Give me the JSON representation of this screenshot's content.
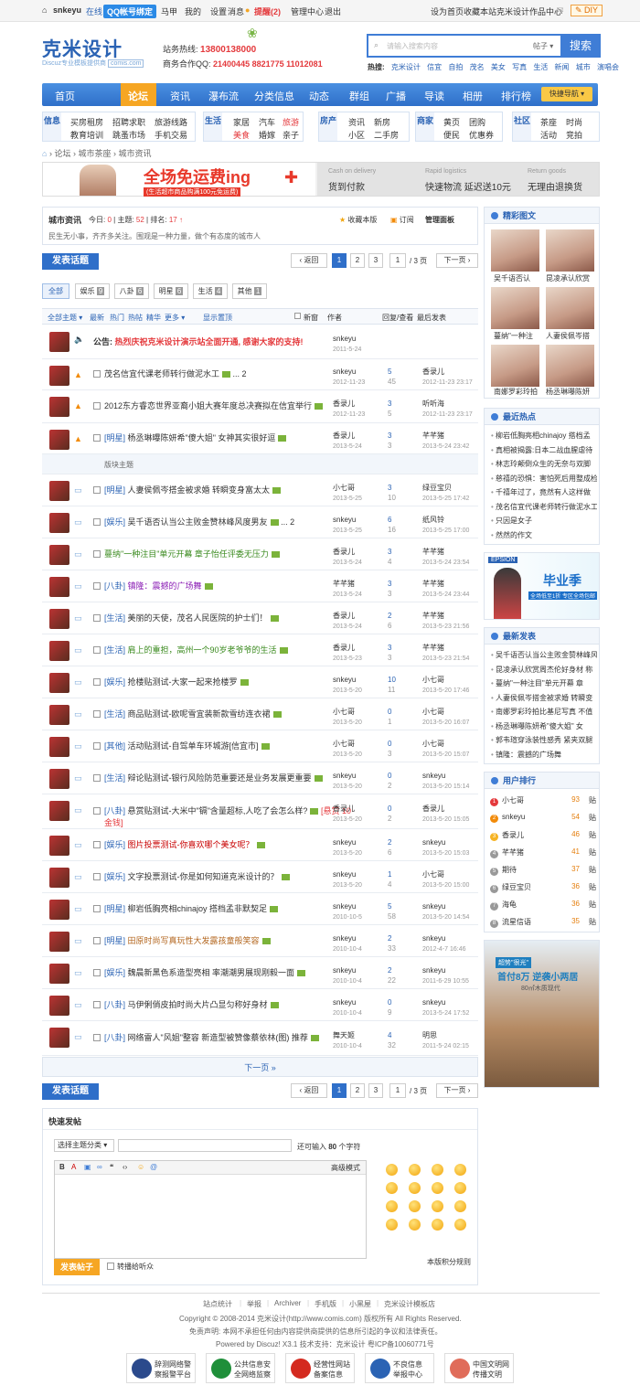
{
  "topbar": {
    "username": "snkeyu",
    "status": "在线",
    "qq_bind": "QQ帐号绑定",
    "links_left": [
      "马甲",
      "我的",
      "设置",
      "消息",
      "提醒(2)",
      "管理中心",
      "退出"
    ],
    "links_right": [
      "设为首页",
      "收藏本站",
      "克米设计作品中心"
    ],
    "diy": "DIY"
  },
  "header": {
    "logo": "克米设计",
    "logo_sub": "Discuz专业模板提供商",
    "logo_domain": "comis.com",
    "hotline_label": "站务热线:",
    "hotline": "13800138000",
    "qq_label": "商务合作QQ:",
    "qq": "21400445 8821775 11012081"
  },
  "search": {
    "placeholder": "请输入搜索内容",
    "type": "帖子",
    "button": "搜索",
    "hot_label": "热搜:",
    "hot": [
      "克米设计",
      "信宜",
      "自拍",
      "茂名",
      "美女",
      "写真",
      "生活",
      "新闻",
      "城市",
      "演唱会"
    ]
  },
  "nav": {
    "items": [
      "首页",
      "论坛",
      "资讯",
      "瀑布流",
      "分类信息",
      "动态",
      "群组",
      "广播",
      "导读",
      "相册",
      "排行榜"
    ],
    "active": "论坛",
    "quick": "快捷导航"
  },
  "categories": [
    {
      "label": "信息",
      "links": [
        "买房租房",
        "招聘求职",
        "旅游线路",
        "教育培训",
        "跳蚤市场",
        "手机交易"
      ]
    },
    {
      "label": "生活",
      "links": [
        "家居",
        "汽车",
        "旅游",
        "美食",
        "婚嫁",
        "亲子"
      ]
    },
    {
      "label": "房产",
      "links": [
        "资讯",
        "新房",
        "小区",
        "二手房"
      ]
    },
    {
      "label": "商家",
      "links": [
        "黄页",
        "团购",
        "便民",
        "优惠券"
      ]
    },
    {
      "label": "社区",
      "links": [
        "茶座",
        "时尚",
        "活动",
        "竞拍"
      ]
    }
  ],
  "breadcrumb": [
    "论坛",
    "城市茶座",
    "城市资讯"
  ],
  "banner": {
    "main": "全场免运费ing",
    "sub": "(生活超市商品购满100元免运费)",
    "items": [
      {
        "en": "Cash on delivery",
        "cn": "货到付款"
      },
      {
        "en": "Rapid logistics",
        "cn": "快速物流 延迟送10元"
      },
      {
        "en": "Return goods",
        "cn": "无理由退换货"
      }
    ]
  },
  "forum": {
    "name": "城市资讯",
    "today_label": "今日:",
    "today": "0",
    "topics_label": "主题:",
    "topics": "52",
    "rank_label": "排名:",
    "rank": "17",
    "fav": "收藏本版",
    "rss": "订阅",
    "manage": "管理面板",
    "desc": "民生无小事，齐齐多关注。围观是一种力量，做个有态度的城市人"
  },
  "post_button": "发表话题",
  "pager": {
    "back": "返回",
    "pages": [
      "1",
      "2",
      "3"
    ],
    "current": "1",
    "total": "/ 3 页",
    "next": "下一页"
  },
  "type_tabs": [
    {
      "label": "全部",
      "count": ""
    },
    {
      "label": "娱乐",
      "count": "9"
    },
    {
      "label": "八卦",
      "count": "6"
    },
    {
      "label": "明星",
      "count": "6"
    },
    {
      "label": "生活",
      "count": "4"
    },
    {
      "label": "其他",
      "count": "1"
    }
  ],
  "list_header": {
    "filters": [
      "全部主题",
      "最新",
      "热门",
      "热帖",
      "精华",
      "更多"
    ],
    "display": "显示置顶",
    "new_label": "新窗",
    "author": "作者",
    "reply_view": "回复/查看",
    "last_post": "最后发表"
  },
  "announcement": {
    "label": "公告:",
    "text": "热烈庆祝克米设计演示站全面开通, 感谢大家的支持!",
    "author": "snkeyu",
    "date": "2011-5-24"
  },
  "sticky": [
    {
      "title": "茂名信宜代课老师转行做泥水工",
      "extra": "... 2",
      "author": "snkeyu",
      "date": "2012-11-23",
      "replies": "5",
      "views": "45",
      "last": "香录儿",
      "last_date": "2012-11-23 23:17"
    },
    {
      "title": "2012东方睿恋世界亚裔小姐大赛年度总决赛拟在信宜举行",
      "extra": "",
      "author": "香录儿",
      "date": "2012-11-23",
      "replies": "3",
      "views": "5",
      "last": "听听海",
      "last_date": "2012-11-23 23:17"
    },
    {
      "tag": "[明星]",
      "title": "杨丞琳曝陈妍希\"傻大姐\" 女神其实很好逗",
      "extra": "",
      "author": "香录儿",
      "date": "2013-5-24",
      "replies": "3",
      "views": "3",
      "last": "芊芊猪",
      "last_date": "2013-5-24 23:42"
    }
  ],
  "section_divider": "版块主题",
  "threads": [
    {
      "tag": "[明星]",
      "title": "人妻侯佩岑搭金被求婚 转瞬变身富太太",
      "extra": "",
      "author": "小七哥",
      "date": "2013-5-25",
      "replies": "3",
      "views": "10",
      "last": "绿豆宝贝",
      "last_date": "2013-5-25 17:42",
      "color": ""
    },
    {
      "tag": "[娱乐]",
      "title": "吴千语否认当公主败金赞林峰风度男友",
      "extra": "... 2",
      "author": "snkeyu",
      "date": "2013-5-25",
      "replies": "6",
      "views": "16",
      "last": "纸风铃",
      "last_date": "2013-5-25 17:00",
      "color": ""
    },
    {
      "tag": "",
      "title": "蔓纳\"一种注目\"单元开幕 章子怡任评委无压力",
      "extra": "",
      "author": "香录儿",
      "date": "2013-5-24",
      "replies": "3",
      "views": "4",
      "last": "芊芊猪",
      "last_date": "2013-5-24 23:54",
      "color": "g"
    },
    {
      "tag": "[八卦]",
      "title": "镇隆：震撼的广场舞",
      "extra": "",
      "author": "芊芊猪",
      "date": "2013-5-24",
      "replies": "3",
      "views": "3",
      "last": "芊芊猪",
      "last_date": "2013-5-24 23:44",
      "color": "pu"
    },
    {
      "tag": "[生活]",
      "title": "美丽的天使，茂名人民医院的护士们！",
      "extra": "",
      "author": "香录儿",
      "date": "2013-5-24",
      "replies": "2",
      "views": "6",
      "last": "芊芊猪",
      "last_date": "2013-5-23 21:56",
      "color": ""
    },
    {
      "tag": "[生活]",
      "title": "肩上的重担，高州一个90岁老爷爷的生活",
      "extra": "",
      "author": "香录儿",
      "date": "2013-5-23",
      "replies": "3",
      "views": "3",
      "last": "芊芊猪",
      "last_date": "2013-5-23 21:54",
      "color": "g"
    },
    {
      "tag": "[娱乐]",
      "title": "抢楼贴测试-大家一起来抢楼罗",
      "extra": "",
      "author": "snkeyu",
      "date": "2013-5-20",
      "replies": "10",
      "views": "11",
      "last": "小七哥",
      "last_date": "2013-5-20 17:46",
      "color": ""
    },
    {
      "tag": "[生活]",
      "title": "商品贴测试-欧呢雪宜装新款雪纺连衣裙",
      "extra": "",
      "author": "小七哥",
      "date": "2013-5-20",
      "replies": "0",
      "views": "1",
      "last": "小七哥",
      "last_date": "2013-5-20 16:07",
      "color": ""
    },
    {
      "tag": "[其他]",
      "title": "活动贴测试-自驾单车环城游[信宜市]",
      "extra": "",
      "author": "小七哥",
      "date": "2013-5-20",
      "replies": "0",
      "views": "3",
      "last": "小七哥",
      "last_date": "2013-5-20 15:07",
      "color": ""
    },
    {
      "tag": "[生活]",
      "title": "辩论贴测试-银行风险防范重要还是业务发展更重要",
      "extra": "",
      "author": "snkeyu",
      "date": "2013-5-20",
      "replies": "0",
      "views": "2",
      "last": "snkeyu",
      "last_date": "2013-5-20 15:14",
      "color": ""
    },
    {
      "tag": "[八卦]",
      "title": "悬赏贴测试-大米中\"镉\"含量超标,人吃了会怎么样?",
      "extra": "[悬赏 10 金钱]",
      "author": "香录儿",
      "date": "2013-5-20",
      "replies": "0",
      "views": "2",
      "last": "香录儿",
      "last_date": "2013-5-20 15:05",
      "color": ""
    },
    {
      "tag": "[娱乐]",
      "title": "图片投票测试-你喜欢哪个美女呢？",
      "extra": "",
      "author": "snkeyu",
      "date": "2013-5-20",
      "replies": "2",
      "views": "6",
      "last": "snkeyu",
      "last_date": "2013-5-20 15:03",
      "color": "o"
    },
    {
      "tag": "[娱乐]",
      "title": "文字投票测试-你是如何知道克米设计的？",
      "extra": "",
      "author": "snkeyu",
      "date": "2013-5-20",
      "replies": "1",
      "views": "4",
      "last": "小七哥",
      "last_date": "2013-5-20 15:00",
      "color": ""
    },
    {
      "tag": "[明星]",
      "title": "柳岩低胸亮相chinajoy 搭档孟非默契足",
      "extra": "",
      "author": "snkeyu",
      "date": "2010-10-5",
      "replies": "5",
      "views": "58",
      "last": "snkeyu",
      "last_date": "2013-5-20 14:54",
      "color": ""
    },
    {
      "tag": "[明星]",
      "title": "田原时尚写真玩性大发露孩童般笑容",
      "extra": "",
      "author": "snkeyu",
      "date": "2010-10-4",
      "replies": "2",
      "views": "33",
      "last": "snkeyu",
      "last_date": "2012-4-7 16:46",
      "color": "br"
    },
    {
      "tag": "[娱乐]",
      "title": "魏晨新黑色系造型亮相 率潮潮男展现刚毅一面",
      "extra": "",
      "author": "snkeyu",
      "date": "2010-10-4",
      "replies": "2",
      "views": "22",
      "last": "snkeyu",
      "last_date": "2011-6-29 10:55",
      "color": ""
    },
    {
      "tag": "[八卦]",
      "title": "马伊俐俏皮拍时尚大片凸显匀称好身材",
      "extra": "",
      "author": "snkeyu",
      "date": "2010-10-4",
      "replies": "0",
      "views": "9",
      "last": "snkeyu",
      "last_date": "2013-5-24 17:52",
      "color": ""
    },
    {
      "tag": "[八卦]",
      "title": "网络雷人\"风姐\"整容 新造型被赞像蔡依林(图) 推荐",
      "extra": "",
      "author": "舞天姬",
      "date": "2010-10-4",
      "replies": "4",
      "views": "32",
      "last": "明思",
      "last_date": "2011-5-24 02:15",
      "color": ""
    }
  ],
  "next_page": "下一页 »",
  "quick_post": {
    "title": "快速发帖",
    "type_select": "选择主题分类",
    "limit_pre": "还可输入",
    "limit": "80",
    "limit_post": "个字符",
    "advanced": "高级模式",
    "submit": "发表帖子",
    "sync": "转播给听众",
    "rules": "本版积分规则"
  },
  "sidebar": {
    "pics_title": "精彩图文",
    "pics": [
      "吴千语否认",
      "昆凌承认欣赏",
      "蔓纳\"一种注",
      "人妻侯佩岑搭",
      "南娜罗彩玲拍",
      "杨丞琳曝陈妍"
    ],
    "hot_title": "最近热点",
    "hot": [
      "柳岩低胸亮相chinajoy 搭档孟",
      "真相被揭露:日本二战血腥虐待",
      "林志玲颠倒众生的无奈与双脚",
      "慈禧的恐惧：害怕死后用整成检",
      "千禧年过了，竟然有人这样做",
      "茂名信宜代课老师转行做泥水工",
      "只因是女子",
      "然然的作文"
    ],
    "ad_brand": "EPSION",
    "ad_text": "毕业季",
    "ad_sub": "全场低至1折 专区全场包邮",
    "new_title": "最新发表",
    "new": [
      "吴千语否认当公主败金赞林峰风",
      "昆凌承认欣赏周杰伦好身材 称",
      "蔓纳\"一种注目\"单元开幕 章",
      "人妻侯佩岑搭金被求婚 转瞬变",
      "南娜罗彩玲拍比基尼写真 不值",
      "杨丞琳曝陈妍希\"傻大姐\" 女",
      "郭韦瑄穿泳装性感秀 紧夹双腿",
      "镇隆：震撼的广场舞"
    ],
    "rank_title": "用户排行",
    "rank": [
      {
        "name": "小七哥",
        "score": "93",
        "unit": "贴"
      },
      {
        "name": "snkeyu",
        "score": "54",
        "unit": "贴"
      },
      {
        "name": "香录儿",
        "score": "46",
        "unit": "贴"
      },
      {
        "name": "芊芊猪",
        "score": "41",
        "unit": "贴"
      },
      {
        "name": "期待",
        "score": "37",
        "unit": "贴"
      },
      {
        "name": "绿豆宝贝",
        "score": "36",
        "unit": "贴"
      },
      {
        "name": "海龟",
        "score": "36",
        "unit": "贴"
      },
      {
        "name": "流星信语",
        "score": "35",
        "unit": "贴"
      }
    ],
    "ad2_title": "首付8万 逆袭小两居",
    "ad2_tag": "超势\"很光\"",
    "ad2_sub": "80㎡木质现代"
  },
  "footer": {
    "links": [
      "站点统计",
      "举报",
      "Archiver",
      "手机版",
      "小黑屋",
      "克米设计模板店"
    ],
    "copyright": "Copyright © 2008-2014 克米设计(http://www.comis.com) 版权所有 All Rights Reserved.",
    "disclaimer": "免责声明: 本网不承担任何由内容提供商提供的信息所引起的争议和法律责任。",
    "powered": "Powered by Discuz! X3.1  技术支持：克米设计  粤ICP备10060771号",
    "badges": [
      {
        "line1": "辞测网络警",
        "line2": "察报警平台"
      },
      {
        "line1": "公共信息安",
        "line2": "全网络监察"
      },
      {
        "line1": "经营性网站",
        "line2": "备案信息"
      },
      {
        "line1": "不良信息",
        "line2": "举报中心"
      },
      {
        "line1": "中国文明网",
        "line2": "传播文明"
      }
    ]
  },
  "colors": {
    "brand": "#2f6fc9",
    "accent": "#f6a623",
    "alert": "#e4393c"
  }
}
